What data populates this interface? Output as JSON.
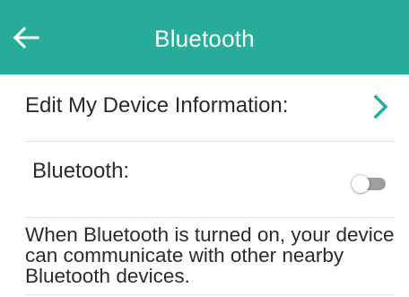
{
  "header": {
    "title": "Bluetooth",
    "back_icon": "arrow-left-icon",
    "background_color": "#27ad99"
  },
  "settings": {
    "edit_device_info": {
      "label": "Edit My Device Information:",
      "icon": "chevron-right-icon",
      "icon_color": "#27ad99"
    },
    "bluetooth": {
      "label": "Bluetooth:",
      "enabled": false
    }
  },
  "description": "When Bluetooth is turned on, your device can communicate with other nearby Bluetooth devices."
}
